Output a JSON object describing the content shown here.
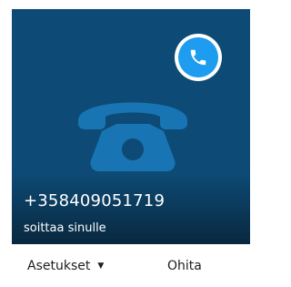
{
  "call": {
    "number": "+358409051719",
    "status": "soittaa sinulle"
  },
  "actions": {
    "settings_label": "Asetukset",
    "ignore_label": "Ohita"
  },
  "icons": {
    "badge": "phone-handset-icon",
    "hero": "desk-phone-icon",
    "settings_caret": "chevron-down-icon"
  },
  "colors": {
    "card_background": "#0d4b76",
    "hero_icon": "#1874b3",
    "badge_accent": "#1d9cf0",
    "text_on_card": "#ffffff"
  }
}
